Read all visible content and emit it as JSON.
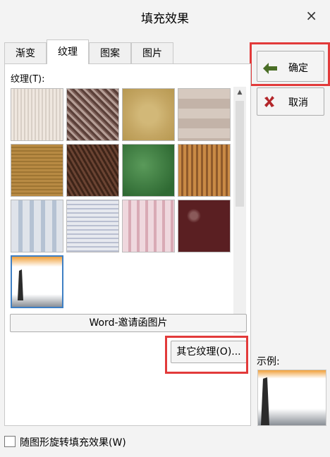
{
  "dialog": {
    "title": "填充效果",
    "close_glyph": "×"
  },
  "tabs": [
    {
      "label": "渐变"
    },
    {
      "label": "纹理"
    },
    {
      "label": "图案"
    },
    {
      "label": "图片"
    }
  ],
  "texture_label": "纹理(T):",
  "textures": [
    {
      "name": "white-cloth"
    },
    {
      "name": "brown-wood-texture"
    },
    {
      "name": "gold-sand"
    },
    {
      "name": "beige-stripes"
    },
    {
      "name": "woven-burlap"
    },
    {
      "name": "brown-bark"
    },
    {
      "name": "green-marble"
    },
    {
      "name": "orange-weave"
    },
    {
      "name": "blue-denim-stripes"
    },
    {
      "name": "gray-plaid"
    },
    {
      "name": "pink-gingham"
    },
    {
      "name": "maroon-floral"
    },
    {
      "name": "custom-image-selected"
    }
  ],
  "word_button": "Word-邀请函图片",
  "other_texture_button": "其它纹理(O)...",
  "ok_button": "确定",
  "cancel_button": "取消",
  "preview_label": "示例:",
  "rotate_checkbox_label": "随图形旋转填充效果(W)",
  "colors": {
    "highlight": "#e23a3a",
    "selection": "#3e7fc4"
  }
}
